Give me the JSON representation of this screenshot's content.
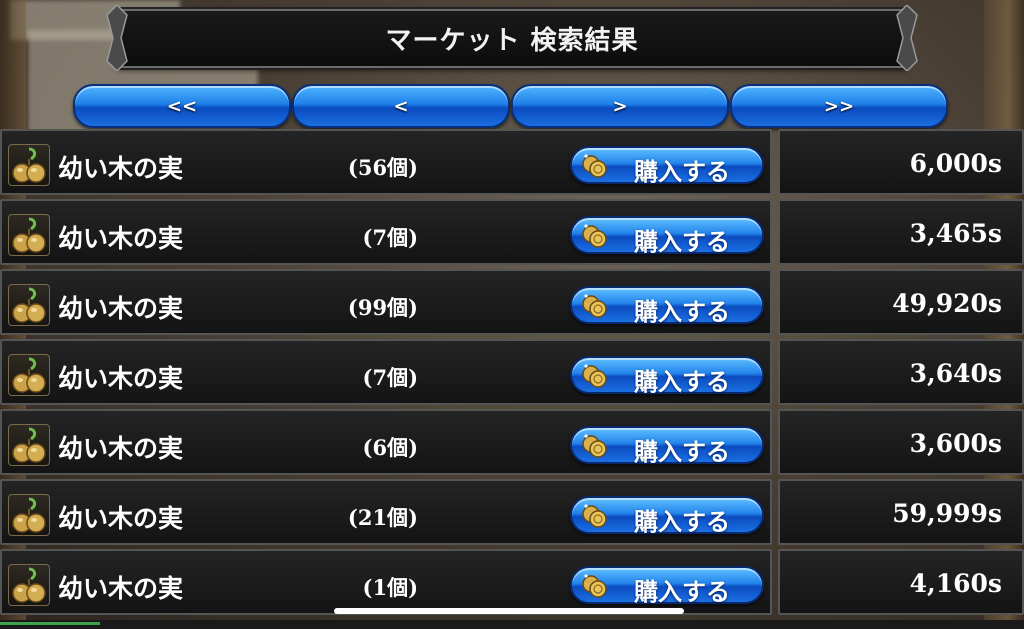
{
  "title": "マーケット 検索結果",
  "nav": {
    "first": "<<",
    "prev": "<",
    "next": ">",
    "last": ">>"
  },
  "icons": {
    "item": "seed-icon",
    "coin": "coin-icon"
  },
  "colors": {
    "button_blue": "#1f7fe8",
    "panel_bg": "#1c1c1c",
    "panel_border": "#555555",
    "text": "#ffffff"
  },
  "listings": [
    {
      "name": "幼い木の実",
      "quantity": "(56個)",
      "buy_label": "購入する",
      "price": "6,000s"
    },
    {
      "name": "幼い木の実",
      "quantity": "(7個)",
      "buy_label": "購入する",
      "price": "3,465s"
    },
    {
      "name": "幼い木の実",
      "quantity": "(99個)",
      "buy_label": "購入する",
      "price": "49,920s"
    },
    {
      "name": "幼い木の実",
      "quantity": "(7個)",
      "buy_label": "購入する",
      "price": "3,640s"
    },
    {
      "name": "幼い木の実",
      "quantity": "(6個)",
      "buy_label": "購入する",
      "price": "3,600s"
    },
    {
      "name": "幼い木の実",
      "quantity": "(21個)",
      "buy_label": "購入する",
      "price": "59,999s"
    },
    {
      "name": "幼い木の実",
      "quantity": "(1個)",
      "buy_label": "購入する",
      "price": "4,160s"
    }
  ]
}
